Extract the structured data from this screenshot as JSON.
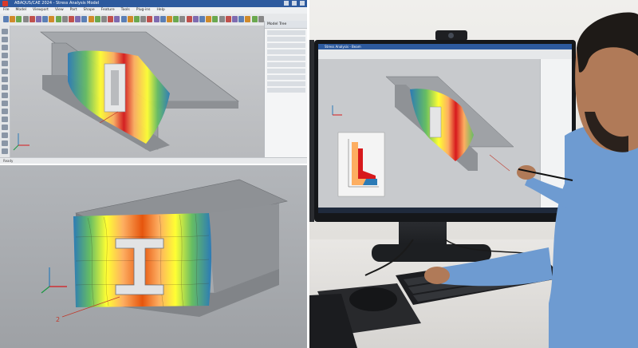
{
  "cad_window": {
    "title": "ABAQUS/CAE 2024 - Stress Analysis Model",
    "menu": [
      "File",
      "Model",
      "Viewport",
      "View",
      "Part",
      "Shape",
      "Feature",
      "Tools",
      "Plug-ins",
      "Help"
    ],
    "panel_header": "Model Tree",
    "status_text": "Ready"
  },
  "monitor_window": {
    "title": "Stress Analysis - Beam"
  },
  "labels": {
    "callout_top": "",
    "callout_bottom": "2"
  },
  "colors": {
    "stress_max": "#d7191c",
    "stress_high": "#fdae61",
    "stress_mid": "#ffff33",
    "stress_low": "#66bd63",
    "stress_min": "#2c7bb6",
    "beam": "#9a9da1",
    "shirt": "#6e9bd1"
  }
}
